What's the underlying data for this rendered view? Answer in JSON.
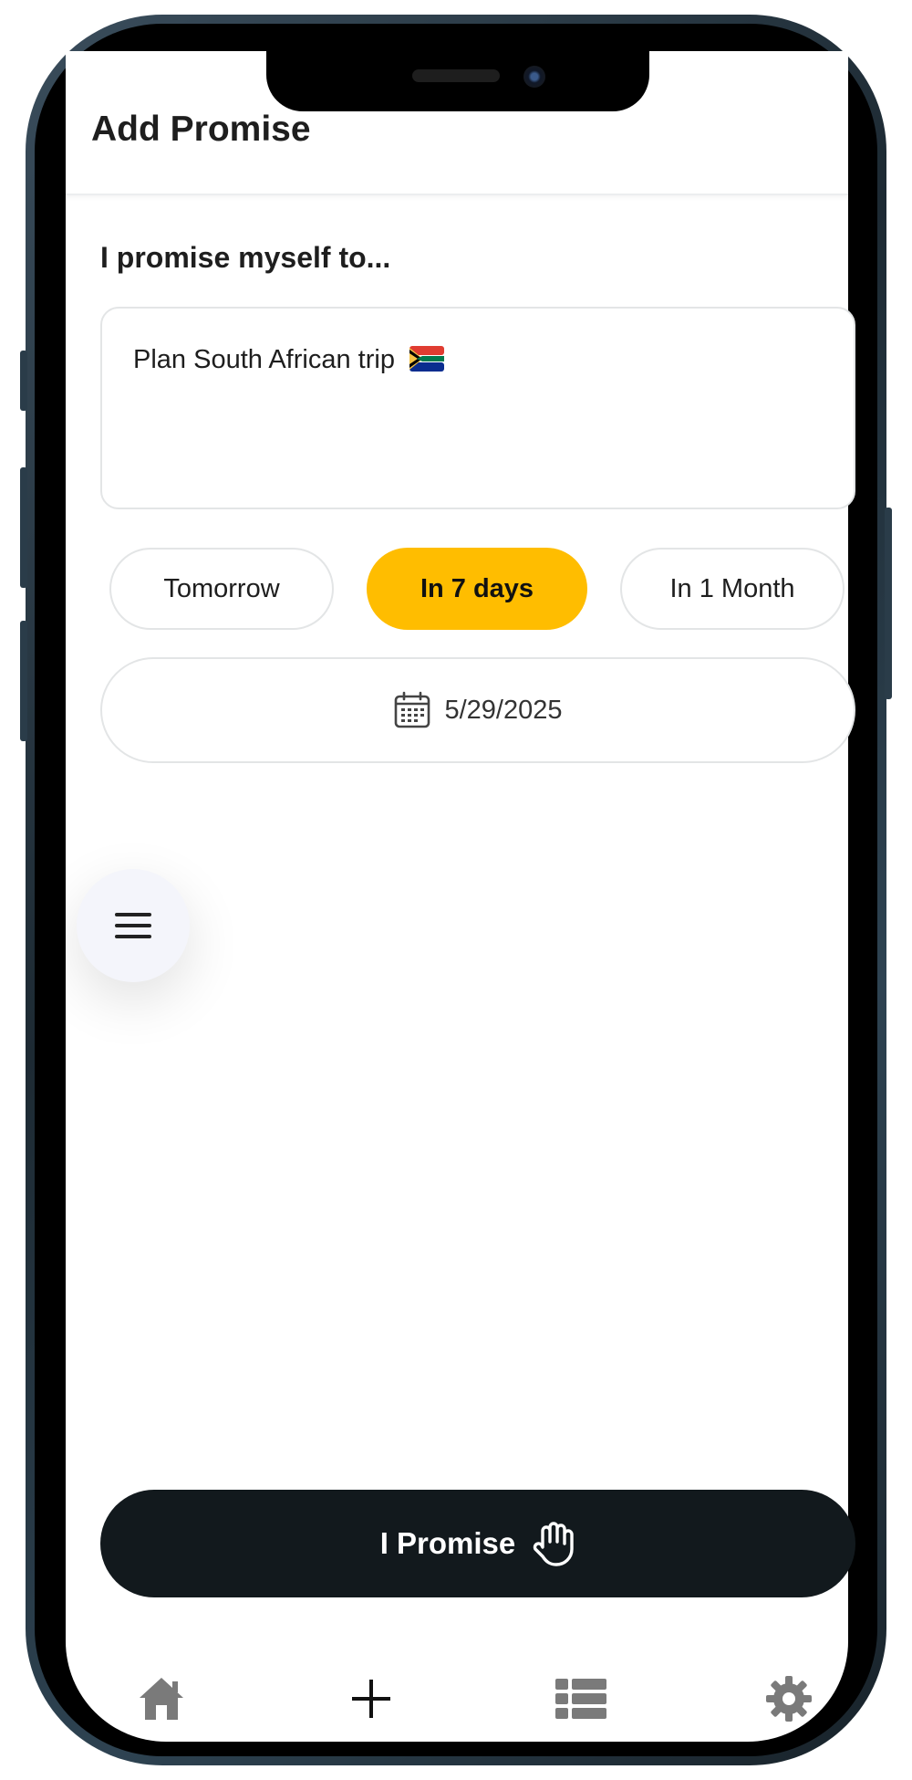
{
  "header": {
    "title": "Add Promise"
  },
  "form": {
    "label": "I promise myself to...",
    "promise_text": "Plan South African trip",
    "flag_icon": "south-africa-flag-icon"
  },
  "quick_dates": [
    {
      "label": "Tomorrow",
      "selected": false
    },
    {
      "label": "In 7 days",
      "selected": true
    },
    {
      "label": "In 1 Month",
      "selected": false
    }
  ],
  "date_picker": {
    "icon": "calendar-icon",
    "value": "5/29/2025"
  },
  "fab": {
    "icon": "menu-icon"
  },
  "submit": {
    "label": "I Promise",
    "icon": "raised-hand-icon"
  },
  "bottom_nav": [
    {
      "icon": "home-icon"
    },
    {
      "icon": "plus-icon"
    },
    {
      "icon": "list-icon"
    },
    {
      "icon": "gear-icon"
    }
  ],
  "colors": {
    "accent": "#ffbd00",
    "button_dark": "#12191d",
    "nav_icon": "#7a7a7a",
    "text": "#1e1e1e"
  }
}
